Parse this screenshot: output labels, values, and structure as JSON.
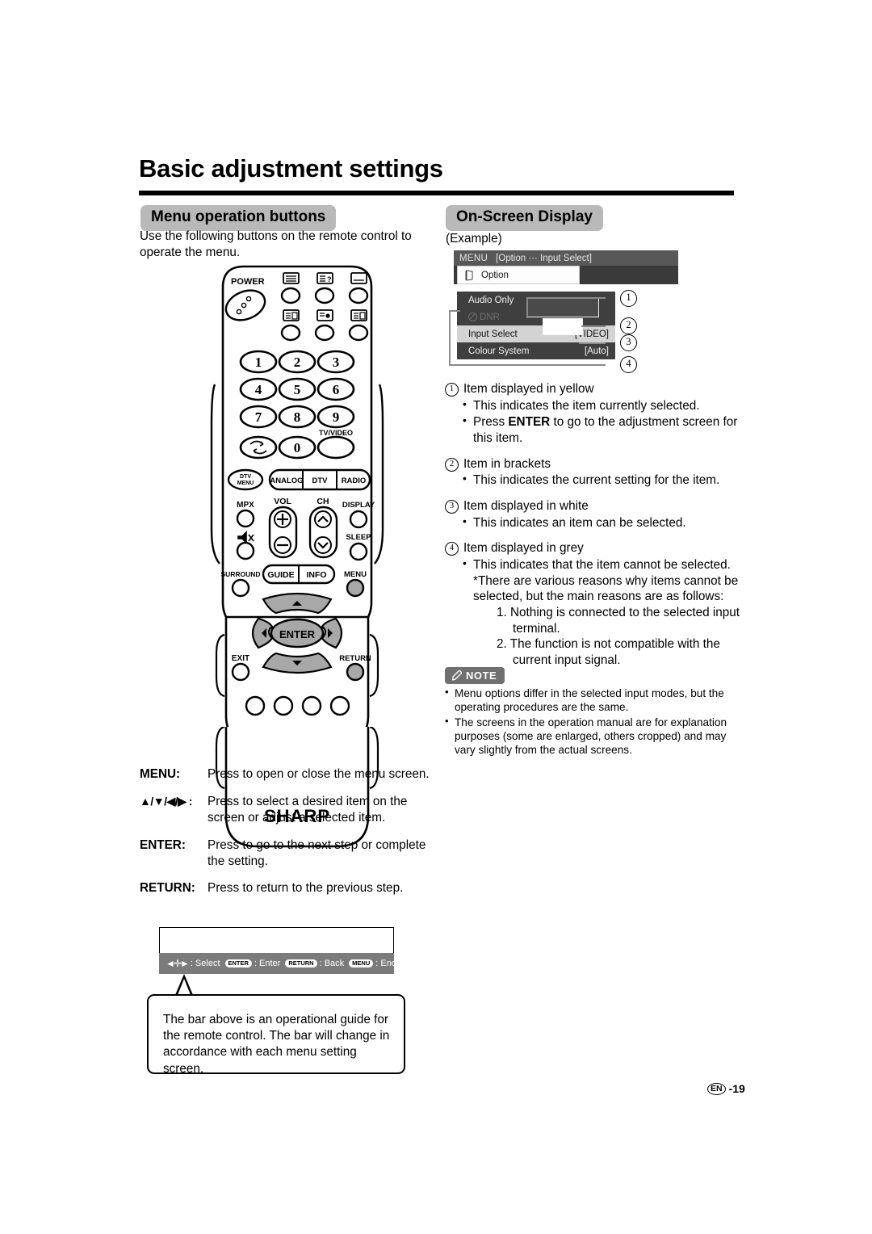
{
  "page": {
    "title": "Basic adjustment settings",
    "footer_locale": "EN",
    "footer_page": "-19"
  },
  "left": {
    "heading": "Menu operation buttons",
    "lead_line1": "Use the following buttons on the remote control to",
    "lead_line2": "operate the menu.",
    "button_descriptions": [
      {
        "key": "MENU:",
        "desc": "Press to open or close the menu screen."
      },
      {
        "key": "▲/▼/◀/▶ :",
        "desc": "Press to select a desired item on the screen or adjust a selected item."
      },
      {
        "key": "ENTER:",
        "desc": "Press to go to the next step or complete the setting."
      },
      {
        "key": "RETURN:",
        "desc": "Press to return to the previous step."
      }
    ],
    "guide_bar": {
      "select_label": ": Select",
      "enter_key": "ENTER",
      "enter_label": ": Enter",
      "return_key": "RETURN",
      "return_label": ": Back",
      "menu_key": "MENU",
      "menu_label": ": End"
    },
    "callout_text": "The bar above is an operational guide for the remote control. The bar will change in accordance with each menu setting screen."
  },
  "remote": {
    "brand": "SHARP",
    "power_label": "POWER",
    "numbers": [
      "1",
      "2",
      "3",
      "4",
      "5",
      "6",
      "7",
      "8",
      "9",
      "0"
    ],
    "tv_video_label": "TV/VIDEO",
    "dtv_menu_label": "DTV MENU",
    "mode_buttons": [
      "ANALOG",
      "DTV",
      "RADIO"
    ],
    "mpx_label": "MPX",
    "vol_label": "VOL",
    "ch_label": "CH",
    "display_label": "DISPLAY",
    "sleep_label": "SLEEP",
    "surround_label": "SURROUND",
    "guide_label": "GUIDE",
    "info_label": "INFO",
    "menu_label": "MENU",
    "exit_label": "EXIT",
    "return_label": "RETURN",
    "enter_label": "ENTER"
  },
  "right": {
    "heading": "On-Screen Display",
    "example_label": "(Example)",
    "osd": {
      "menu_title": "MENU",
      "menu_path": "[Option ··· Input Select]",
      "tab_label": "Option",
      "rows": [
        {
          "label": "Audio Only",
          "value": "",
          "state": "white"
        },
        {
          "label": "DNR",
          "value": "",
          "state": "grey"
        },
        {
          "label": "Input Select",
          "value": "[VIDEO]",
          "state": "selected"
        },
        {
          "label": "Colour System",
          "value": "[Auto]",
          "state": "white"
        }
      ],
      "callouts": [
        "1",
        "2",
        "3",
        "4"
      ]
    },
    "items": [
      {
        "num": "1",
        "title": "Item displayed in yellow",
        "bullets": [
          "This indicates the item currently selected.",
          "Press ENTER to go to the adjustment screen for this item."
        ]
      },
      {
        "num": "2",
        "title": "Item in brackets",
        "bullets": [
          "This indicates the current setting for the item."
        ]
      },
      {
        "num": "3",
        "title": "Item displayed in white",
        "bullets": [
          "This indicates an item can be selected."
        ]
      },
      {
        "num": "4",
        "title": "Item displayed in grey",
        "bullets": [
          "This indicates that the item cannot be selected."
        ],
        "note": "*There are various reasons why items cannot be selected, but the main reasons are as follows:",
        "reasons": [
          "1. Nothing is connected to the selected input terminal.",
          "2. The function is not compatible with the current input signal."
        ]
      }
    ],
    "note": {
      "badge": "NOTE",
      "bullets": [
        "Menu options differ in the selected input modes, but the operating procedures are the same.",
        "The screens in the operation manual are for explanation purposes (some are enlarged, others cropped) and may vary slightly from the actual screens."
      ]
    }
  },
  "colors": {
    "pill_bg": "#b9b9b9",
    "osd_bar": "#585858",
    "osd_panel": "#3f3f3f",
    "osd_selected": "#d3d3d3",
    "osd_grey_text": "#6e6e6e",
    "guide_bar": "#7b7b7b",
    "note_badge": "#707070"
  }
}
